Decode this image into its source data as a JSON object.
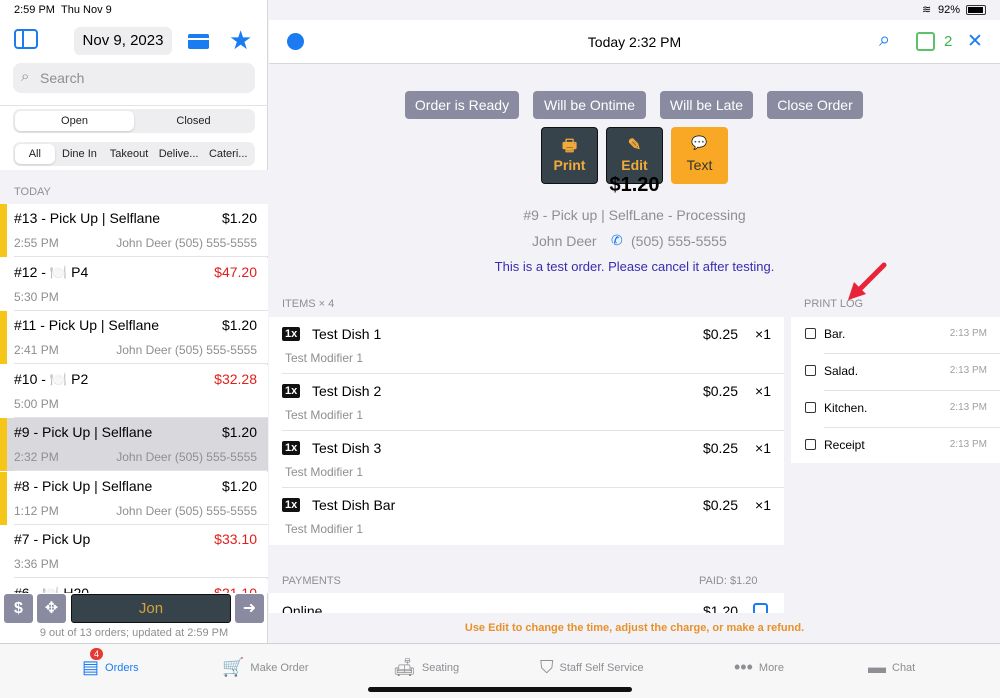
{
  "status": {
    "time": "2:59 PM",
    "date": "Thu Nov 9",
    "battery": "92%"
  },
  "sidebar": {
    "date": "Nov 9, 2023",
    "search_placeholder": "Search",
    "status_tabs": [
      "Open",
      "Closed"
    ],
    "type_tabs": [
      "All",
      "Dine In",
      "Takeout",
      "Delive...",
      "Cateri..."
    ],
    "section": "TODAY",
    "orders": [
      {
        "title": "#13 - Pick Up | Selflane",
        "price": "$1.20",
        "time": "2:55 PM",
        "customer": "John Deer (505) 555-5555",
        "flag": true,
        "red": false
      },
      {
        "title": "#12 - 🍽️ P4",
        "price": "$47.20",
        "time": "5:30 PM",
        "customer": "",
        "flag": false,
        "red": true
      },
      {
        "title": "#11 - Pick Up | Selflane",
        "price": "$1.20",
        "time": "2:41 PM",
        "customer": "John Deer (505) 555-5555",
        "flag": true,
        "red": false
      },
      {
        "title": "#10 - 🍽️ P2",
        "price": "$32.28",
        "time": "5:00 PM",
        "customer": "",
        "flag": false,
        "red": true
      },
      {
        "title": "#9 - Pick Up | Selflane",
        "price": "$1.20",
        "time": "2:32 PM",
        "customer": "John Deer (505) 555-5555",
        "flag": true,
        "red": false,
        "selected": true
      },
      {
        "title": "#8 - Pick Up | Selflane",
        "price": "$1.20",
        "time": "1:12 PM",
        "customer": "John Deer (505) 555-5555",
        "flag": true,
        "red": false
      },
      {
        "title": "#7 - Pick Up",
        "price": "$33.10",
        "time": "3:36 PM",
        "customer": "",
        "flag": false,
        "red": true
      },
      {
        "title": "#6 - 🍽️ H20",
        "price": "$21.10",
        "time": "",
        "customer": "",
        "flag": false,
        "red": true
      }
    ],
    "user": "Jon",
    "footer": "9 out of 13 orders; updated at 2:59 PM"
  },
  "header": {
    "title": "Today 2:32 PM",
    "printer_count": "2"
  },
  "actions": [
    "Order is Ready",
    "Will be Ontime",
    "Will be Late",
    "Close Order"
  ],
  "buttons": {
    "print": "Print",
    "edit": "Edit",
    "text": "Text"
  },
  "order": {
    "total": "$1.20",
    "subtitle": "#9 - Pick up | SelfLane - Processing",
    "customer": "John Deer",
    "phone": "(505) 555-5555",
    "note": "This is a test order. Please cancel it after testing."
  },
  "items_header": "ITEMS × 4",
  "items": [
    {
      "qty": "1x",
      "name": "Test Dish 1",
      "modifier": "Test Modifier 1",
      "price": "$0.25",
      "count": "×1"
    },
    {
      "qty": "1x",
      "name": "Test Dish 2",
      "modifier": "Test Modifier 1",
      "price": "$0.25",
      "count": "×1"
    },
    {
      "qty": "1x",
      "name": "Test Dish 3",
      "modifier": "Test Modifier 1",
      "price": "$0.25",
      "count": "×1"
    },
    {
      "qty": "1x",
      "name": "Test Dish Bar",
      "modifier": "Test Modifier 1",
      "price": "$0.25",
      "count": "×1"
    }
  ],
  "payments": {
    "header": "PAYMENTS",
    "paid": "PAID: $1.20",
    "method": "Online",
    "amount": "$1.20"
  },
  "print_log": {
    "header": "PRINT LOG",
    "entries": [
      {
        "name": "Bar.",
        "time": "2:13 PM"
      },
      {
        "name": "Salad.",
        "time": "2:13 PM"
      },
      {
        "name": "Kitchen.",
        "time": "2:13 PM"
      },
      {
        "name": "Receipt",
        "time": "2:13 PM"
      }
    ]
  },
  "edit_hint": "Use Edit to change the time, adjust the charge, or make a refund.",
  "tabs": [
    {
      "label": "Orders",
      "badge": "4",
      "active": true
    },
    {
      "label": "Make Order"
    },
    {
      "label": "Seating"
    },
    {
      "label": "Staff Self Service"
    },
    {
      "label": "More"
    },
    {
      "label": "Chat"
    }
  ],
  "colors": {
    "accent": "#1a7cf0",
    "flag": "#f5c518",
    "action": "#f2a93b",
    "note": "#3a2bb0",
    "hint": "#e8912a"
  }
}
